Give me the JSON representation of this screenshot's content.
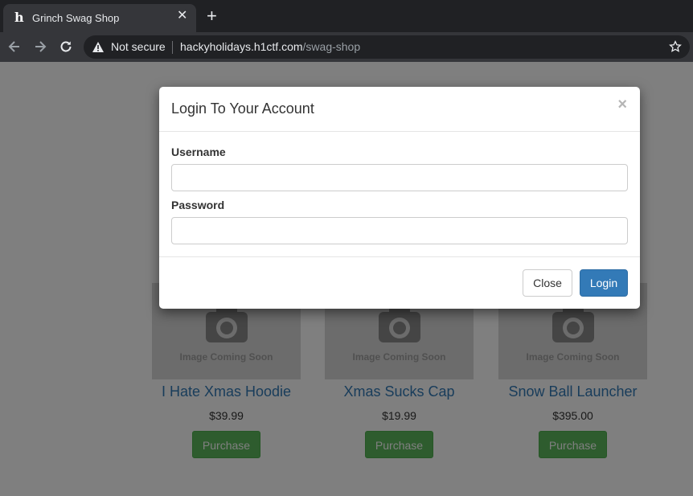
{
  "browser": {
    "tab_title": "Grinch Swag Shop",
    "tab_favicon": "h",
    "security_label": "Not secure",
    "url_host": "hackyholidays.h1ctf.com",
    "url_path": "/swag-shop"
  },
  "products": [
    {
      "name": "I Hate Xmas Hoodie",
      "price": "$39.99",
      "image_text": "Image Coming Soon",
      "button": "Purchase"
    },
    {
      "name": "Xmas Sucks Cap",
      "price": "$19.99",
      "image_text": "Image Coming Soon",
      "button": "Purchase"
    },
    {
      "name": "Snow Ball Launcher",
      "price": "$395.00",
      "image_text": "Image Coming Soon",
      "button": "Purchase"
    }
  ],
  "modal": {
    "title": "Login To Your Account",
    "close_symbol": "×",
    "username_label": "Username",
    "username_value": "",
    "password_label": "Password",
    "password_value": "",
    "close_button": "Close",
    "login_button": "Login"
  },
  "colors": {
    "primary": "#337ab7",
    "success": "#5cb85c",
    "link": "#337ab7"
  }
}
